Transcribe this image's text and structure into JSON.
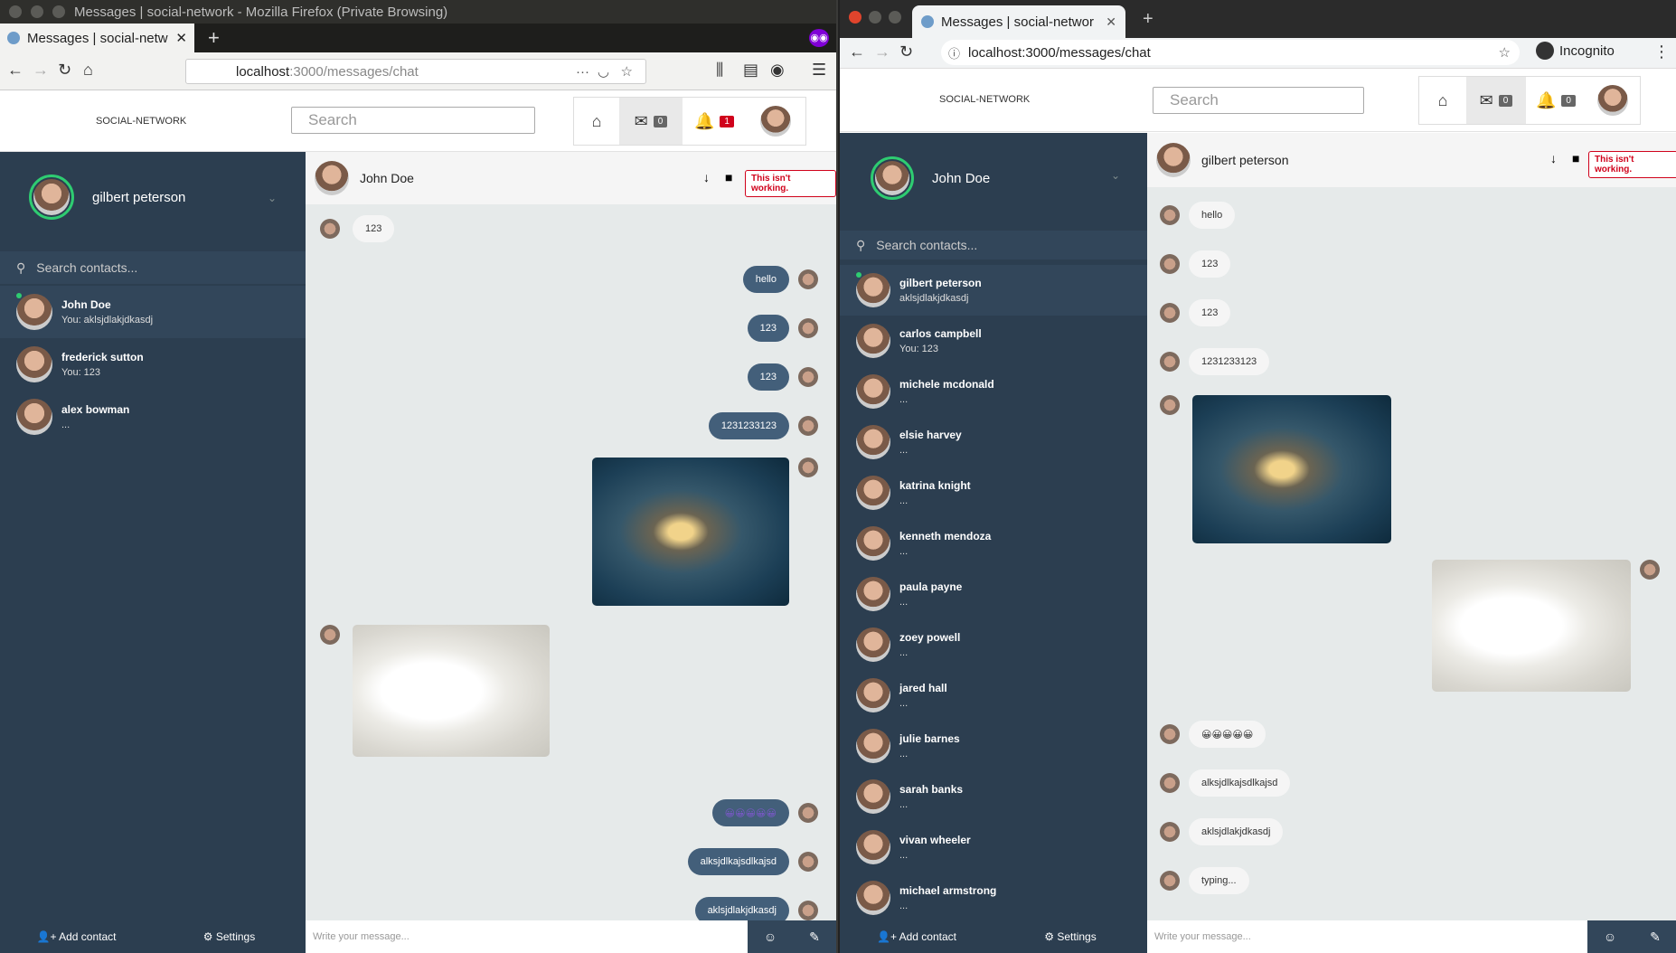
{
  "left": {
    "window_title": "Messages | social-network - Mozilla Firefox (Private Browsing)",
    "tab_title": "Messages | social-netwo",
    "url_host": "localhost",
    "url_path": ":3000/messages/chat",
    "brand": "SOCIAL-NETWORK",
    "search_placeholder": "Search",
    "messenger_count": "0",
    "notif_count": "1",
    "profile_name": "gilbert peterson",
    "contact_search": "Search contacts...",
    "contacts": [
      {
        "name": "John Doe",
        "preview": "You: aklsjdlakjdkasdj"
      },
      {
        "name": "frederick sutton",
        "preview": "You: 123"
      },
      {
        "name": "alex bowman",
        "preview": "..."
      }
    ],
    "chat_name": "John Doe",
    "not_working": "This isn't working.",
    "messages": [
      "123",
      "hello",
      "123",
      "123",
      "1231233123",
      "😀😀😀😀😀",
      "alksjdlkajsdlkajsd",
      "aklsjdlakjdkasdj"
    ],
    "compose_placeholder": "Write your message...",
    "add_contact": "Add contact",
    "settings": "Settings"
  },
  "right": {
    "tab_title": "Messages | social-networ",
    "url": "localhost:3000/messages/chat",
    "incognito": "Incognito",
    "brand": "SOCIAL-NETWORK",
    "search_placeholder": "Search",
    "messenger_count": "0",
    "notif_count": "0",
    "profile_name": "John Doe",
    "contact_search": "Search contacts...",
    "contacts": [
      {
        "name": "gilbert peterson",
        "preview": "aklsjdlakjdkasdj"
      },
      {
        "name": "carlos campbell",
        "preview": "You: 123"
      },
      {
        "name": "michele mcdonald",
        "preview": "..."
      },
      {
        "name": "elsie harvey",
        "preview": "..."
      },
      {
        "name": "katrina knight",
        "preview": "..."
      },
      {
        "name": "kenneth mendoza",
        "preview": "..."
      },
      {
        "name": "paula payne",
        "preview": "..."
      },
      {
        "name": "zoey powell",
        "preview": "..."
      },
      {
        "name": "jared hall",
        "preview": "..."
      },
      {
        "name": "julie barnes",
        "preview": "..."
      },
      {
        "name": "sarah banks",
        "preview": "..."
      },
      {
        "name": "vivan wheeler",
        "preview": "..."
      },
      {
        "name": "michael armstrong",
        "preview": "..."
      }
    ],
    "chat_name": "gilbert peterson",
    "not_working": "This isn't working.",
    "messages": [
      "hello",
      "123",
      "123",
      "1231233123",
      "😀😀😀😀😀",
      "alksjdlkajsdlkajsd",
      "aklsjdlakjdkasdj",
      "typing..."
    ],
    "compose_placeholder": "Write your message...",
    "add_contact": "Add contact",
    "settings": "Settings"
  }
}
